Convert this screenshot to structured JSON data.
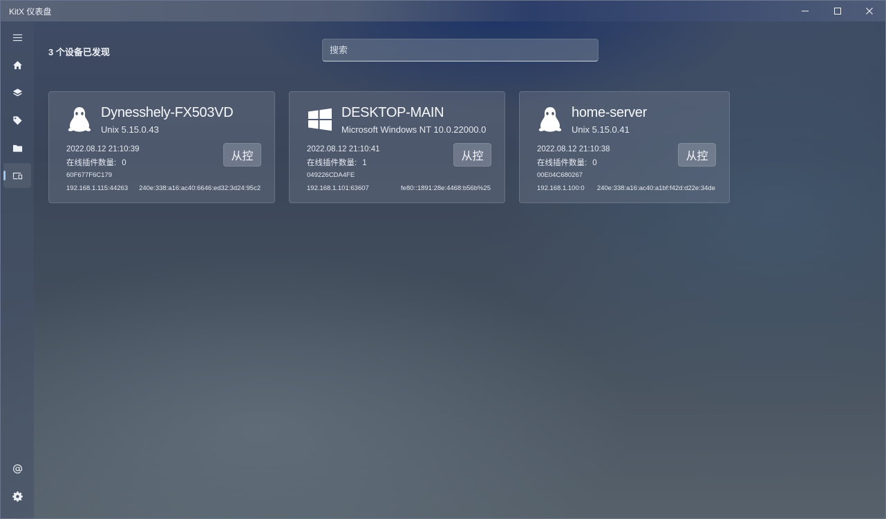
{
  "window": {
    "title": "KitX 仪表盘",
    "controls": {
      "minimize_icon": "minimize-icon",
      "maximize_icon": "maximize-icon",
      "close_icon": "close-icon"
    }
  },
  "sidebar": {
    "top_items": [
      {
        "icon": "hamburger-menu-icon"
      },
      {
        "icon": "home-icon"
      },
      {
        "icon": "layers-icon"
      },
      {
        "icon": "tag-icon"
      },
      {
        "icon": "folder-icon"
      },
      {
        "icon": "devices-icon",
        "active": true
      }
    ],
    "bottom_items": [
      {
        "icon": "at-icon"
      },
      {
        "icon": "gear-icon"
      }
    ],
    "active_indicator_color": "#9ec7f0"
  },
  "header": {
    "device_count": "3 个设备已发现",
    "search_placeholder": "搜索"
  },
  "devices": [
    {
      "icon": "linux-penguin-icon",
      "name": "Dynesshely-FX503VD",
      "os": "Unix 5.15.0.43",
      "time": "2022.08.12 21:10:39",
      "plugins_label": "在线插件数量:",
      "plugins_count": "0",
      "device_id": "60F677F6C179",
      "ipv4": "192.168.1.115:44263",
      "ipv6": "240e:338:a16:ac40:6646:ed32:3d24:95c2",
      "control_label": "从控"
    },
    {
      "icon": "windows-logo-icon",
      "name": "DESKTOP-MAIN",
      "os": "Microsoft Windows NT 10.0.22000.0",
      "time": "2022.08.12 21:10:41",
      "plugins_label": "在线插件数量:",
      "plugins_count": "1",
      "device_id": "049226CDA4FE",
      "ipv4": "192.168.1.101:63607",
      "ipv6": "fe80::1891:28e:4468:b56b%25",
      "control_label": "从控"
    },
    {
      "icon": "linux-penguin-icon",
      "name": "home-server",
      "os": "Unix 5.15.0.41",
      "time": "2022.08.12 21:10:38",
      "plugins_label": "在线插件数量:",
      "plugins_count": "0",
      "device_id": "00E04C680267",
      "ipv4": "192.168.1.100:0",
      "ipv6": "240e:338:a16:ac40:a1bf:f42d:d22e:34de",
      "control_label": "从控"
    }
  ]
}
